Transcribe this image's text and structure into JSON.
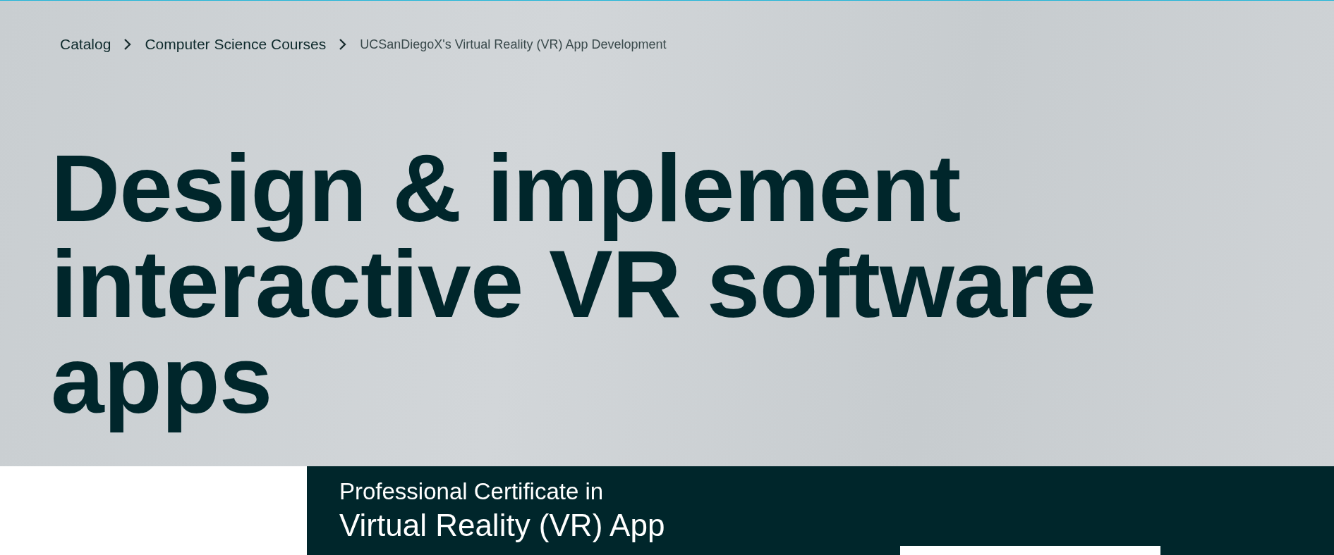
{
  "breadcrumb": [
    {
      "label": "Catalog",
      "kind": "link"
    },
    {
      "label": "Computer Science Courses",
      "kind": "link"
    },
    {
      "label": "UCSanDiegoX's Virtual Reality (VR) App Development",
      "kind": "current"
    }
  ],
  "hero": {
    "title": "Design & implement interactive VR software apps"
  },
  "program": {
    "type_label": "Professional Certificate in",
    "title": "Virtual Reality (VR) App"
  }
}
